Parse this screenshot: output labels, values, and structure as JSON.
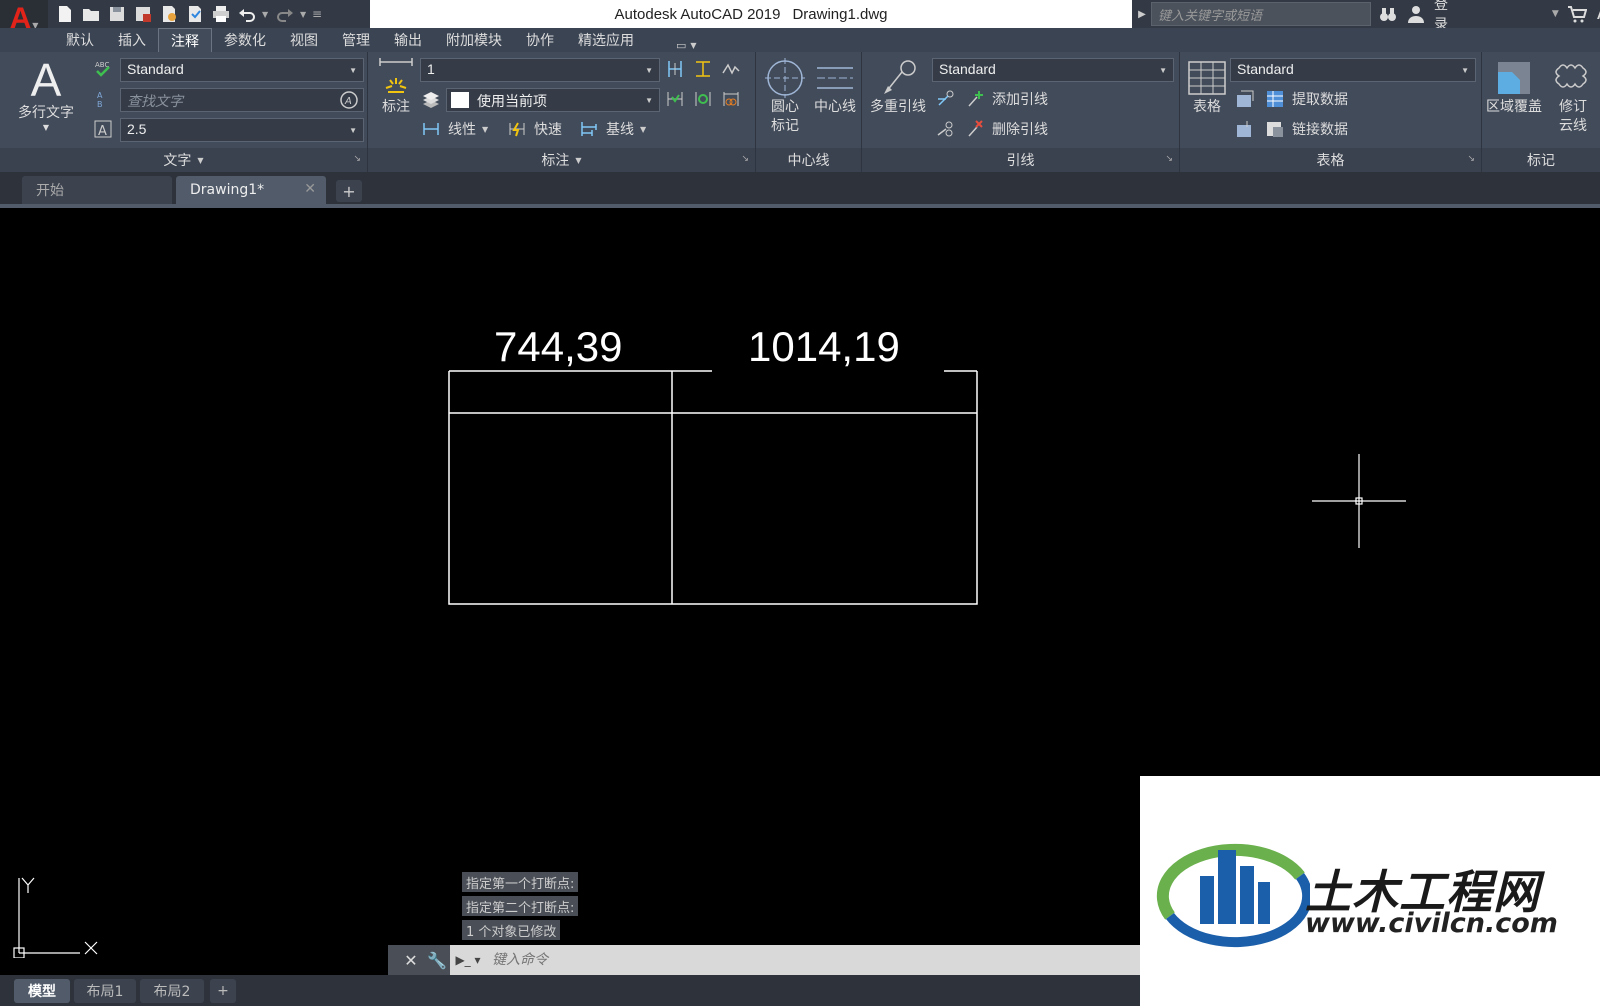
{
  "window": {
    "app_name": "Autodesk AutoCAD 2019",
    "file_name": "Drawing1.dwg",
    "search_placeholder": "键入关键字或短语",
    "signin_label": "登录"
  },
  "ribbon_tabs": [
    "默认",
    "插入",
    "注释",
    "参数化",
    "视图",
    "管理",
    "输出",
    "附加模块",
    "协作",
    "精选应用"
  ],
  "active_tab": "注释",
  "panels": {
    "text": {
      "title": "文字",
      "big_button": "多行文字",
      "style_value": "Standard",
      "find_placeholder": "查找文字",
      "height_value": "2.5"
    },
    "dimension": {
      "title": "标注",
      "big_button": "标注",
      "dim_style_value": "1",
      "layer_value": "使用当前项",
      "linear_label": "线性",
      "quick_label": "快速",
      "baseline_label": "基线"
    },
    "centerline": {
      "title": "中心线",
      "center_mark_label": "圆心\n标记",
      "centerline_label": "中心线"
    },
    "leader": {
      "title": "引线",
      "big_button": "多重引线",
      "style_value": "Standard",
      "add_leader_label": "添加引线",
      "remove_leader_label": "删除引线"
    },
    "table": {
      "title": "表格",
      "big_button": "表格",
      "style_value": "Standard",
      "extract_label": "提取数据",
      "link_label": "链接数据"
    },
    "markup": {
      "title": "标记",
      "wipeout_label": "区域覆盖",
      "revcloud_label": "修订\n云线"
    }
  },
  "file_tabs": {
    "start_label": "开始",
    "drawing_label": "Drawing1*"
  },
  "drawing": {
    "dim_left": "744,39",
    "dim_right": "1014,19"
  },
  "ucs": {
    "x_label": "X",
    "y_label": "Y"
  },
  "command_history": [
    "指定第一个打断点:",
    "指定第二个打断点:",
    "1 个对象已修改"
  ],
  "command_placeholder": "键入命令",
  "layout_tabs": [
    "模型",
    "布局1",
    "布局2"
  ],
  "watermark": {
    "title": "土木工程网",
    "url": "www.civilcn.com"
  },
  "colors": {
    "canvas": "#000000",
    "ribbon": "#424b5a",
    "brand_red": "#e2231a",
    "brand_blue": "#1b5faa",
    "brand_green": "#6ab04c"
  }
}
